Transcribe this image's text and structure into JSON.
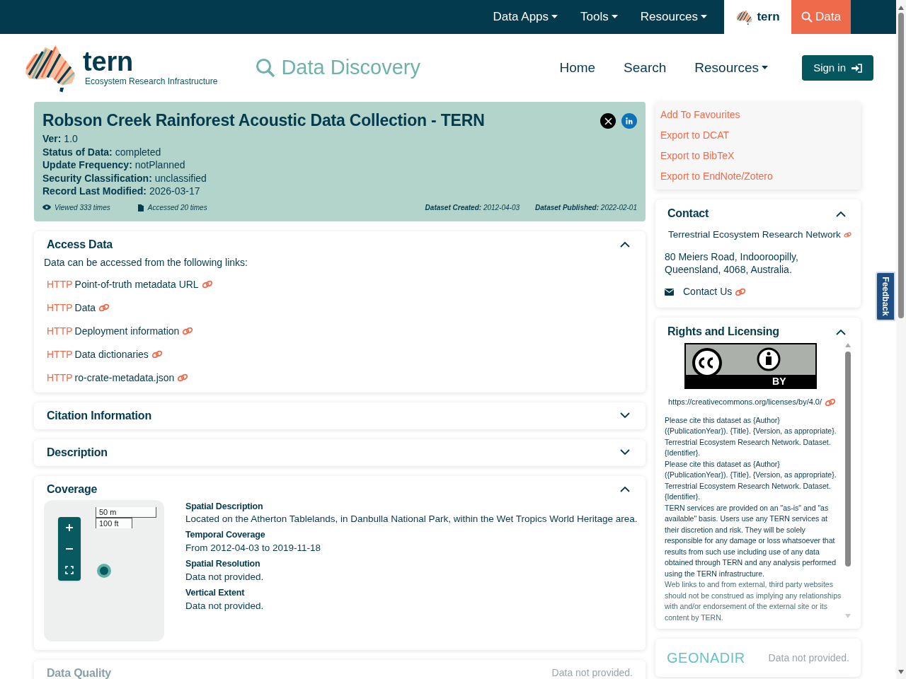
{
  "top_nav": {
    "items": [
      {
        "label": "Data Apps",
        "dropdown": true
      },
      {
        "label": "Tools",
        "dropdown": true
      },
      {
        "label": "Resources",
        "dropdown": true
      }
    ],
    "brand": "tern",
    "data_button": "Data"
  },
  "header": {
    "logo_word": "tern",
    "logo_tagline": "Ecosystem Research Infrastructure",
    "app_title": "Data Discovery",
    "nav": [
      {
        "label": "Home",
        "dropdown": false
      },
      {
        "label": "Search",
        "dropdown": false
      },
      {
        "label": "Resources",
        "dropdown": true
      }
    ],
    "sign_in": "Sign in"
  },
  "dataset": {
    "title": "Robson Creek Rainforest Acoustic Data Collection - TERN",
    "fields": [
      {
        "label": "Ver:",
        "value": "1.0"
      },
      {
        "label": "Status of Data:",
        "value": "completed"
      },
      {
        "label": "Update Frequency:",
        "value": "notPlanned"
      },
      {
        "label": "Security Classification:",
        "value": "unclassified"
      },
      {
        "label": "Record Last Modified:",
        "value": "2026-03-17"
      }
    ],
    "viewed": "Viewed 333 times",
    "accessed": "Accessed 20 times",
    "dates": [
      {
        "label": "Dataset Created:",
        "value": "2012-04-03"
      },
      {
        "label": "Dataset Published:",
        "value": "2022-02-01"
      }
    ]
  },
  "sections": [
    {
      "kind": "links",
      "title": "Access Data",
      "expanded": true,
      "disabled": false,
      "intro": "Data can be accessed from the following links:",
      "links": [
        {
          "protocol": "HTTP",
          "label": "Point-of-truth metadata URL"
        },
        {
          "protocol": "HTTP",
          "label": "Data"
        },
        {
          "protocol": "HTTP",
          "label": "Deployment information"
        },
        {
          "protocol": "HTTP",
          "label": "Data dictionaries"
        },
        {
          "protocol": "HTTP",
          "label": "ro-crate-metadata.json"
        }
      ]
    },
    {
      "kind": "collapsed",
      "title": "Citation Information",
      "expanded": false,
      "disabled": false
    },
    {
      "kind": "collapsed",
      "title": "Description",
      "expanded": false,
      "disabled": false
    },
    {
      "kind": "coverage",
      "title": "Coverage",
      "expanded": true,
      "disabled": false,
      "map": {
        "scale_metric": "50 m",
        "scale_imperial": "100 ft"
      },
      "details": [
        {
          "label": "Spatial Description",
          "value": "Located on the Atherton Tablelands, in Danbulla National Park, within the Wet Tropics World Heritage area."
        },
        {
          "label": "Temporal Coverage",
          "value": "From 2012-04-03 to 2019-11-18"
        },
        {
          "label": "Spatial Resolution",
          "value": "Data not provided."
        },
        {
          "label": "Vertical Extent",
          "value": "Data not provided."
        }
      ]
    },
    {
      "kind": "empty",
      "title": "Data Quality",
      "disabled": true,
      "value": "Data not provided."
    }
  ],
  "sidebar": {
    "actions": [
      "Add To Favourites",
      "Export to DCAT",
      "Export to BibTeX",
      "Export to EndNote/Zotero"
    ],
    "contact": {
      "title": "Contact",
      "expanded": true,
      "organisation": "Terrestrial Ecosystem Research Network",
      "address": "80 Meiers Road, Indooroopilly, Queensland, 4068, Australia.",
      "contact_us": "Contact Us"
    },
    "rights": {
      "title": "Rights and Licensing",
      "expanded": true,
      "badge_label": "BY",
      "license_url": "https://creativecommons.org/licenses/by/4.0/",
      "paragraphs": [
        "Please cite this dataset as {Author} ({PublicationYear}). {Title}. {Version, as appropriate}. Terrestrial Ecosystem Research Network. Dataset. {Identifier}.",
        "Please cite this dataset as {Author} ({PublicationYear}). {Title}. {Version, as appropriate}. Terrestrial Ecosystem Research Network. Dataset. {Identifier}.",
        "TERN services are provided on an \"as-is\" and \"as available\" basis. Users use any TERN services at their discretion and risk. They will be solely responsible for any damage or loss whatsoever that results from such use including use of any data obtained through TERN and any analysis performed using the TERN infrastructure.",
        "Web links to and from external, third party websites should not be construed as implying any relationships with and/or endorsement of the external site or its content by TERN."
      ]
    },
    "geonadir": {
      "logo": "GEONADIR",
      "value": "Data not provided."
    }
  },
  "feedback": "Feedback"
}
